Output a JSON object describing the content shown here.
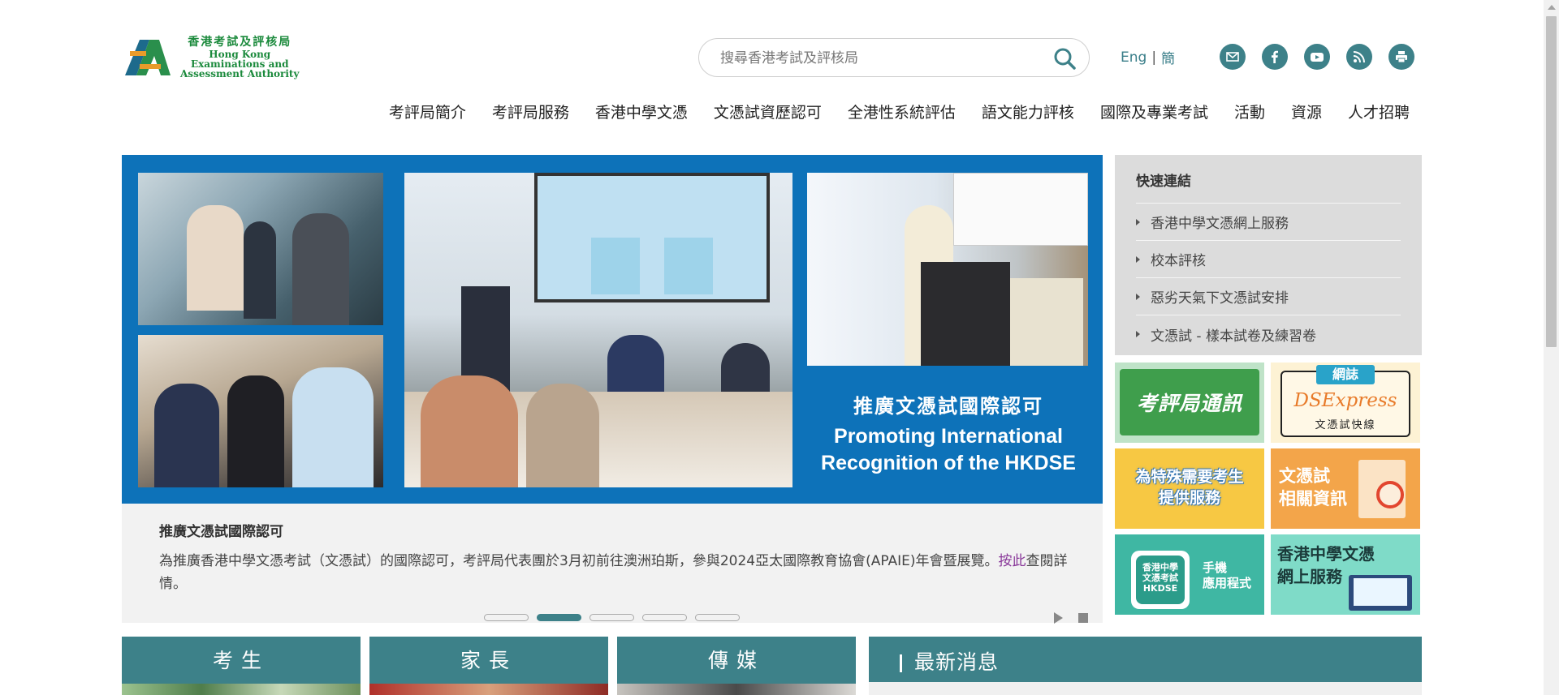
{
  "header": {
    "logo": {
      "zh": "香港考試及評核局",
      "en_line1": "Hong Kong",
      "en_line2": "Examinations and",
      "en_line3": "Assessment Authority"
    },
    "search": {
      "placeholder": "搜尋香港考試及評核局"
    },
    "lang": {
      "english": "Eng",
      "separator": "|",
      "simplified": "簡"
    },
    "social_icons": [
      "email-icon",
      "facebook-icon",
      "youtube-icon",
      "rss-icon",
      "print-icon"
    ]
  },
  "nav": {
    "items": [
      "考評局簡介",
      "考評局服務",
      "香港中學文憑",
      "文憑試資歷認可",
      "全港性系統評估",
      "語文能力評核",
      "國際及專業考試",
      "活動",
      "資源",
      "人才招聘"
    ]
  },
  "slider": {
    "banner_zh": "推廣文憑試國際認可",
    "banner_en_line1": "Promoting International",
    "banner_en_line2": "Recognition of the HKDSE",
    "caption_title": "推廣文憑試國際認可",
    "caption_body": "為推廣香港中學文憑考試（文憑試）的國際認可，考評局代表團於3月初前往澳洲珀斯，參與2024亞太國際教育協會(APAIE)年會暨展覽。",
    "caption_link": "按此",
    "caption_tail": "查閱詳情。",
    "dots_total": 5,
    "active_dot": 2
  },
  "quick_links": {
    "title": "快速連結",
    "items": [
      "香港中學文憑網上服務",
      "校本評核",
      "惡劣天氣下文憑試安排",
      "文憑試 - 樣本試卷及練習卷"
    ]
  },
  "tiles": {
    "t1": "考評局通訊",
    "t2_tag": "網誌",
    "t2_title": "DSExpress",
    "t2_sub": "文憑試快線",
    "t3_line1": "為特殊需要考生",
    "t3_line2": "提供服務",
    "t4_line1": "文憑試",
    "t4_line2": "相關資訊",
    "t5_app_line1": "香港中學",
    "t5_app_line2": "文憑考試",
    "t5_app_line3": "HKDSE",
    "t5_line1": "手機",
    "t5_line2": "應用程式",
    "t6_line1": "香港中學文憑",
    "t6_line2": "網上服務"
  },
  "bottom_tabs": {
    "candidates": "考生",
    "parents": "家長",
    "media": "傳媒",
    "news": "最新消息"
  },
  "colors": {
    "teal": "#3d8189",
    "banner_blue": "#0d72b9",
    "logo_green": "#1b8a3c"
  }
}
